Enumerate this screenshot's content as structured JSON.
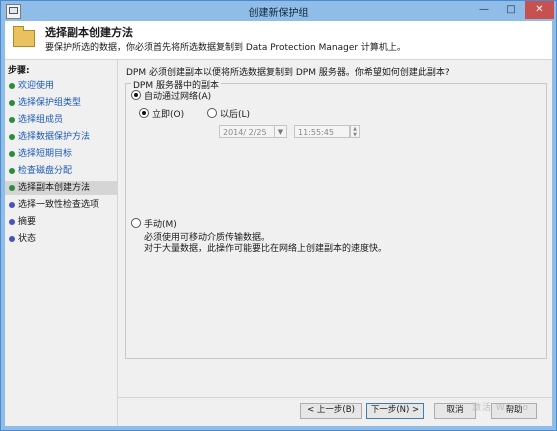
{
  "window": {
    "title": "创建新保护组",
    "minimize": "—",
    "maximize": "□",
    "close": "✕"
  },
  "header": {
    "title": "选择副本创建方法",
    "description": "要保护所选的数据，你必须首先将所选数据复制到 Data Protection Manager 计算机上。"
  },
  "steps": {
    "label": "步骤:",
    "items": [
      {
        "label": "欢迎使用",
        "state": "done"
      },
      {
        "label": "选择保护组类型",
        "state": "done"
      },
      {
        "label": "选择组成员",
        "state": "done"
      },
      {
        "label": "选择数据保护方法",
        "state": "done"
      },
      {
        "label": "选择短期目标",
        "state": "done"
      },
      {
        "label": "检查磁盘分配",
        "state": "done"
      },
      {
        "label": "选择副本创建方法",
        "state": "current"
      },
      {
        "label": "选择一致性检查选项",
        "state": "pending"
      },
      {
        "label": "摘要",
        "state": "pending"
      },
      {
        "label": "状态",
        "state": "pending"
      }
    ]
  },
  "main": {
    "question": "DPM 必须创建副本以便将所选数据复制到 DPM 服务器。你希望如何创建此副本?",
    "group_title": "DPM 服务器中的副本",
    "auto_label": "自动通过网络(A)",
    "now_label": "立即(O)",
    "later_label": "以后(L)",
    "date_value": "2014/ 2/25",
    "time_value": "11:55:45",
    "manual_label": "手动(M)",
    "manual_desc1": "必须使用可移动介质传输数据。",
    "manual_desc2": "对于大量数据，此操作可能要比在网络上创建副本的速度快。"
  },
  "footer": {
    "back": "< 上一步(B)",
    "next": "下一步(N) >",
    "cancel": "取消",
    "help": "帮助"
  },
  "watermark": "激活 Windo"
}
